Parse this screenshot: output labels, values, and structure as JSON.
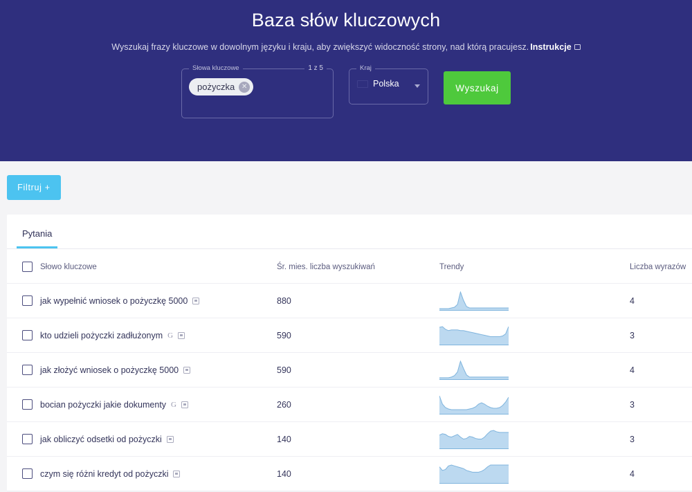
{
  "hero": {
    "title": "Baza słów kluczowych",
    "subtitle": "Wyszukaj frazy kluczowe w dowolnym języku i kraju, aby zwiększyć widoczność strony, nad którą pracujesz.",
    "instructions_label": "Instrukcje",
    "instructions_icon": "external-link-icon",
    "bg_color": "#2f2f7e"
  },
  "form": {
    "keywords_legend": "Słowa kluczowe",
    "keywords_counter": "1 z 5",
    "chips": [
      {
        "label": "pożyczka",
        "remove_icon": "close-circle-icon"
      }
    ],
    "country_legend": "Kraj",
    "country_value": "Polska",
    "country_flag": "flag-poland-icon",
    "country_caret": "chevron-down-icon",
    "search_button": "Wyszukaj",
    "search_button_color": "#4ec93c"
  },
  "toolbar": {
    "filter_label": "Filtruj +",
    "filter_color": "#4cc3f0"
  },
  "tabs": [
    {
      "label": "Pytania",
      "active": true
    }
  ],
  "table": {
    "headers": {
      "select_all": "select-all-checkbox",
      "keyword": "Słowo kluczowe",
      "volume": "Śr. mies. liczba wyszukiwań",
      "trend": "Trendy",
      "words": "Liczba wyrazów"
    },
    "rows": [
      {
        "checked": false,
        "keyword": "jak wypełnić wniosek o pożyczkę 5000",
        "badges": [
          "question-badge-icon"
        ],
        "volume": "880",
        "words": "4",
        "trend_points": [
          2,
          2,
          2,
          2,
          3,
          4,
          8,
          26,
          14,
          5,
          3,
          3,
          3,
          3,
          3,
          3,
          3,
          3,
          3,
          3,
          3,
          3,
          3,
          3
        ]
      },
      {
        "checked": false,
        "keyword": "kto udzieli pożyczki zadłużonym",
        "badges": [
          "google-icon",
          "question-badge-icon"
        ],
        "volume": "590",
        "words": "3",
        "trend_points": [
          26,
          27,
          23,
          21,
          22,
          22,
          22,
          21,
          21,
          20,
          19,
          18,
          17,
          16,
          15,
          14,
          13,
          12,
          12,
          12,
          12,
          13,
          16,
          27
        ]
      },
      {
        "checked": false,
        "keyword": "jak złożyć wniosek o pożyczkę 5000",
        "badges": [
          "question-badge-icon"
        ],
        "volume": "590",
        "words": "4",
        "trend_points": [
          2,
          2,
          2,
          2,
          3,
          5,
          10,
          25,
          15,
          6,
          3,
          3,
          3,
          3,
          3,
          3,
          3,
          3,
          3,
          3,
          3,
          3,
          3,
          3
        ]
      },
      {
        "checked": false,
        "keyword": "bocian pożyczki jakie dokumenty",
        "badges": [
          "google-icon",
          "question-badge-icon"
        ],
        "volume": "260",
        "words": "3",
        "trend_points": [
          26,
          14,
          9,
          7,
          6,
          6,
          6,
          6,
          6,
          6,
          7,
          8,
          10,
          14,
          16,
          14,
          11,
          9,
          8,
          8,
          9,
          12,
          17,
          24
        ]
      },
      {
        "checked": false,
        "keyword": "jak obliczyć odsetki od pożyczki",
        "badges": [
          "question-badge-icon"
        ],
        "volume": "140",
        "words": "3",
        "trend_points": [
          20,
          22,
          21,
          18,
          17,
          19,
          21,
          17,
          14,
          15,
          18,
          17,
          15,
          14,
          14,
          17,
          22,
          26,
          27,
          25,
          24,
          24,
          24,
          24
        ]
      },
      {
        "checked": false,
        "keyword": "czym się różni kredyt od pożyczki",
        "badges": [
          "question-badge-icon"
        ],
        "volume": "140",
        "words": "4",
        "trend_points": [
          18,
          14,
          15,
          19,
          20,
          19,
          18,
          17,
          16,
          14,
          13,
          12,
          12,
          12,
          13,
          15,
          18,
          20,
          20,
          20,
          20,
          20,
          20,
          20
        ]
      }
    ],
    "trend_color": "#bcd9f0",
    "trend_line_color": "#7fb4dd"
  }
}
